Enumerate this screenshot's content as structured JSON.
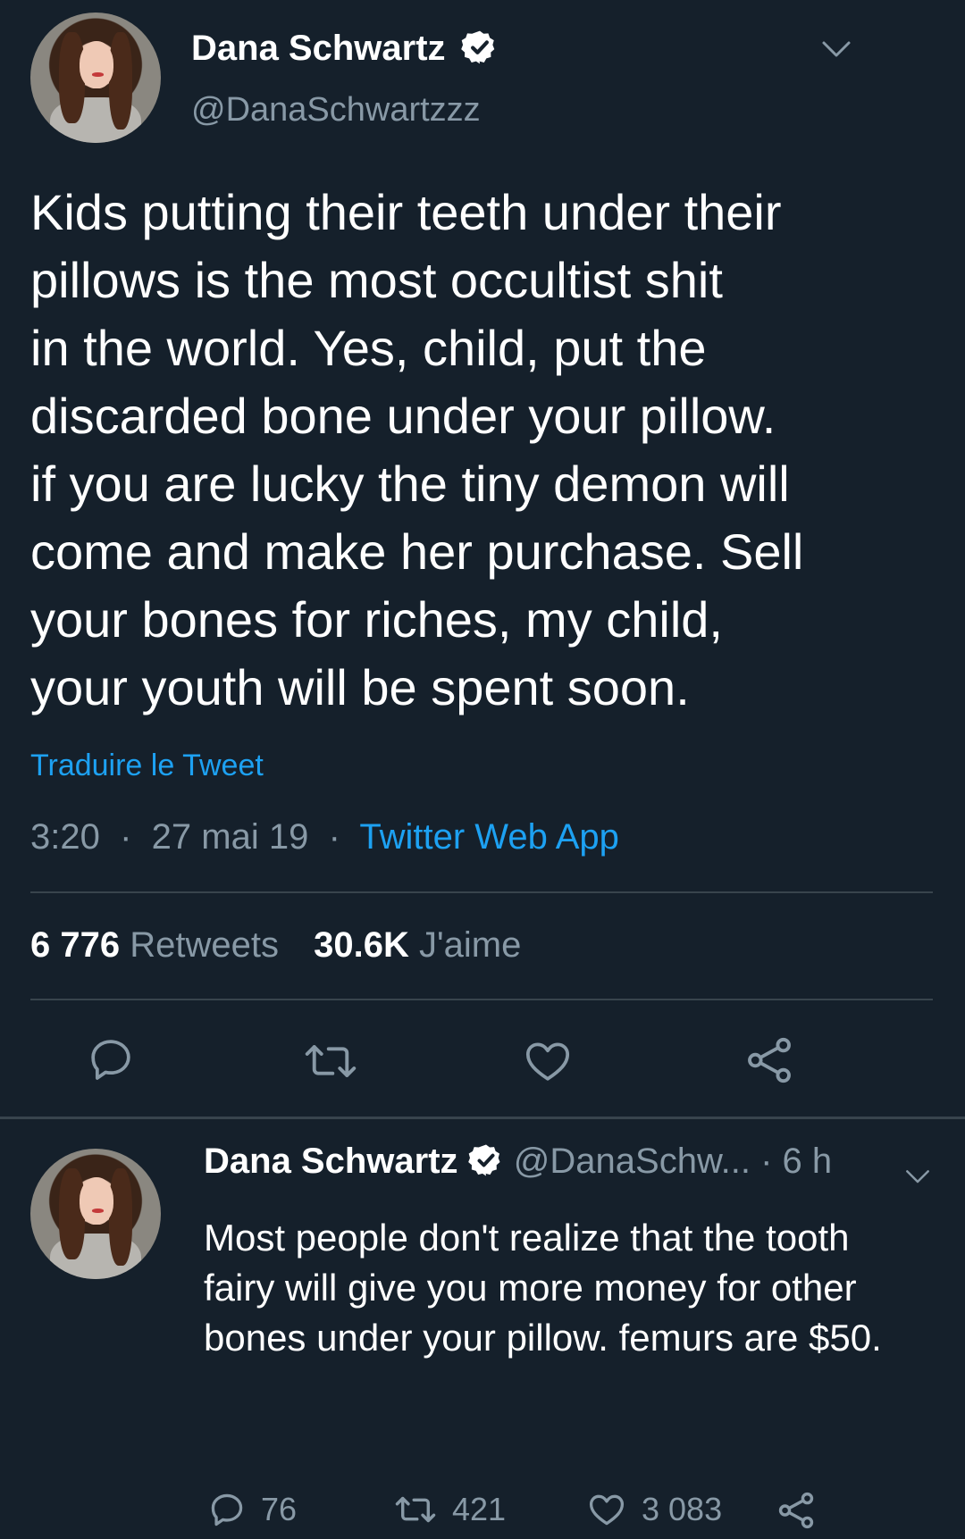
{
  "tweet": {
    "author_name": "Dana Schwartz",
    "author_handle": "@DanaSchwartzzz",
    "text": "Kids putting their teeth under their\npillows is the most occultist shit\nin the world. Yes, child, put the\ndiscarded bone under your pillow.\nif you are lucky the tiny demon will\ncome and make her purchase. Sell\nyour bones for riches, my child,\nyour youth will be spent soon.",
    "translate_label": "Traduire le Tweet",
    "time": "3:20",
    "date": "27 mai 19",
    "source": "Twitter Web App",
    "retweets_count": "6 776",
    "retweets_label": "Retweets",
    "likes_count": "30.6K",
    "likes_label": "J'aime"
  },
  "reply": {
    "author_name": "Dana Schwartz",
    "author_handle": "@DanaSchw...",
    "time_ago": "6 h",
    "text": "Most people don't realize that the tooth\nfairy will give you more money for other\nbones under your pillow. femurs are $50.",
    "reply_count": "76",
    "retweet_count": "421",
    "like_count": "3 083"
  },
  "colors": {
    "background": "#15202b",
    "accent": "#1da1f2",
    "secondary_text": "#8899a6",
    "divider": "#38444d"
  }
}
